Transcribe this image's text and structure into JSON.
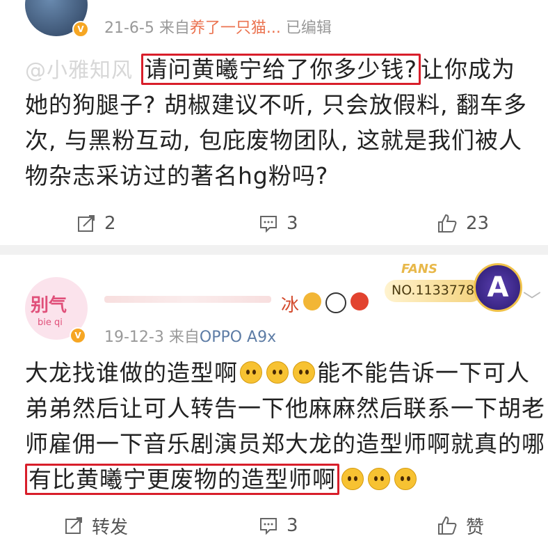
{
  "post1": {
    "meta": {
      "date": "21-6-5",
      "from": "来自",
      "source": "养了一只猫...",
      "edited": "已编辑"
    },
    "text": {
      "mention": "@小雅知风",
      "highlight": "请问黄曦宁给了你多少钱?",
      "line1_rest": "让你成为",
      "line2": "她的狗腿子? 胡椒建议不听, 只会放假料, 翻车多",
      "line3": "次, 与黑粉互动, 包庇废物团队, 这就是我们被人",
      "line4": "物杂志采访过的著名hg粉吗?"
    },
    "actions": {
      "repost_count": "2",
      "comment_count": "3",
      "like_count": "23"
    }
  },
  "post2": {
    "avatar_text": "别气",
    "avatar_sub": "bie qi",
    "name_suffix": "冰",
    "fans": {
      "label": "FANS",
      "number": "NO.1133778",
      "letter": "A"
    },
    "meta": {
      "date": "19-12-3",
      "from": "来自",
      "source": "OPPO A9x"
    },
    "text": {
      "line1a": "大龙找谁做的造型啊",
      "line1b": "能不能告诉一下可人",
      "line2": "弟弟然后让可人转告一下他麻麻然后联系一下胡老",
      "line3": "师雇佣一下音乐剧演员郑大龙的造型师啊就真的哪",
      "highlight": "有比黄曦宁更废物的造型师啊"
    },
    "actions": {
      "repost_label": "转发",
      "comment_count": "3",
      "like_label": "赞"
    }
  },
  "colors": {
    "highlight_border": "#d81e2a",
    "link": "#5d7ca5",
    "source_orange": "#eb7350",
    "verified": "#f6a623"
  }
}
